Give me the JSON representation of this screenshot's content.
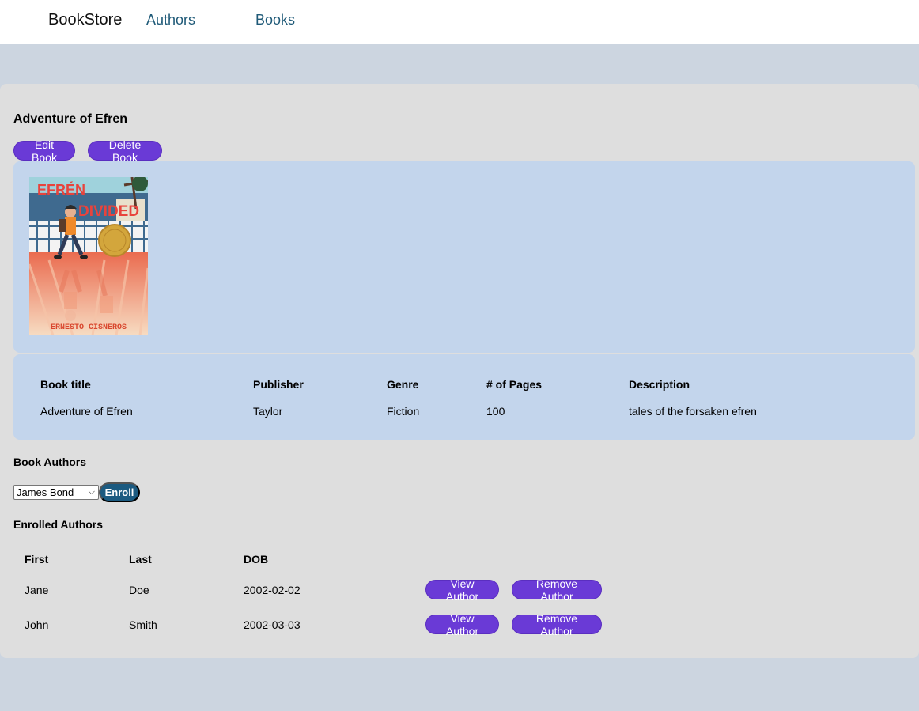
{
  "navbar": {
    "brand": "BookStore",
    "links": [
      "Authors",
      "Books"
    ]
  },
  "book": {
    "title": "Adventure of Efren",
    "edit_label": "Edit Book",
    "delete_label": "Delete Book",
    "cover": {
      "title_line1": "EFRÉN",
      "title_line2": "DIVIDED",
      "author": "ERNESTO CISNEROS"
    },
    "details": {
      "headers": [
        "Book title",
        "Publisher",
        "Genre",
        "# of Pages",
        "Description"
      ],
      "values": [
        "Adventure of Efren",
        "Taylor",
        "Fiction",
        "100",
        "tales of the forsaken efren"
      ]
    }
  },
  "book_authors": {
    "label": "Book Authors",
    "select_value": "James Bond",
    "enroll_label": "Enroll"
  },
  "enrolled": {
    "label": "Enrolled Authors",
    "headers": [
      "First",
      "Last",
      "DOB"
    ],
    "rows": [
      {
        "first": "Jane",
        "last": "Doe",
        "dob": "2002-02-02"
      },
      {
        "first": "John",
        "last": "Smith",
        "dob": "2002-03-03"
      }
    ],
    "view_label": "View Author",
    "remove_label": "Remove Author"
  },
  "colors": {
    "primary_button": "#6a3ad6",
    "enroll_button": "#1b5a80",
    "panel": "#c3d5ec",
    "card": "#dedede",
    "background": "#ccd5e0"
  }
}
